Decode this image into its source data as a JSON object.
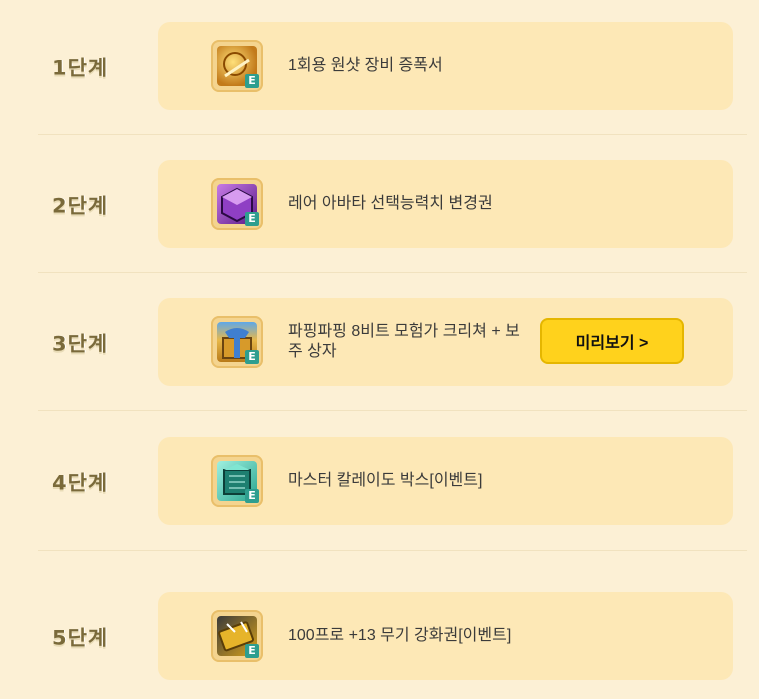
{
  "stages": [
    {
      "label": "1단계",
      "item": "1회용 원샷 장비 증폭서",
      "icon": "amplifier-scroll-icon",
      "icon_color": "#c27a1a"
    },
    {
      "label": "2단계",
      "item": "레어 아바타 선택능력치 변경권",
      "icon": "purple-cube-icon",
      "icon_color": "#6a2a9c"
    },
    {
      "label": "3단계",
      "item": "파핑파핑 8비트 모험가 크리쳐 + 보주 상자",
      "icon": "gift-box-icon",
      "icon_color": "#c99a2a",
      "button": "미리보기 >"
    },
    {
      "label": "4단계",
      "item": "마스터 칼레이도 박스[이벤트]",
      "icon": "teal-box-icon",
      "icon_color": "#2aa58f"
    },
    {
      "label": "5단계",
      "item": "100프로 +13 무기 강화권[이벤트]",
      "icon": "enhance-ticket-icon",
      "icon_color": "#d8a21c"
    }
  ],
  "badge_letter": "E"
}
